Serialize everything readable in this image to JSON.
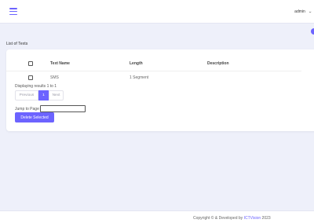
{
  "header": {
    "menu_icon": "hamburger-menu-icon",
    "username": "admin",
    "dropdown_icon": "chevron-down-icon",
    "accent": "#6c63ff"
  },
  "page": {
    "title": "List of Texts"
  },
  "table": {
    "columns": [
      "Text Name",
      "Length",
      "Description"
    ],
    "rows": [
      {
        "name": "SMS",
        "length": "1 Segment",
        "description": ""
      }
    ]
  },
  "pagination": {
    "summary": "Displaying results 1 to 1",
    "previous_label": "Previous",
    "current_page": "1",
    "next_label": "Next"
  },
  "jump": {
    "label": "Jump to Page",
    "value": ""
  },
  "actions": {
    "delete_label": "Delete Selected"
  },
  "footer": {
    "prefix": "Copyright © & Developed by",
    "brand": "ICTVision",
    "year": "2023"
  }
}
